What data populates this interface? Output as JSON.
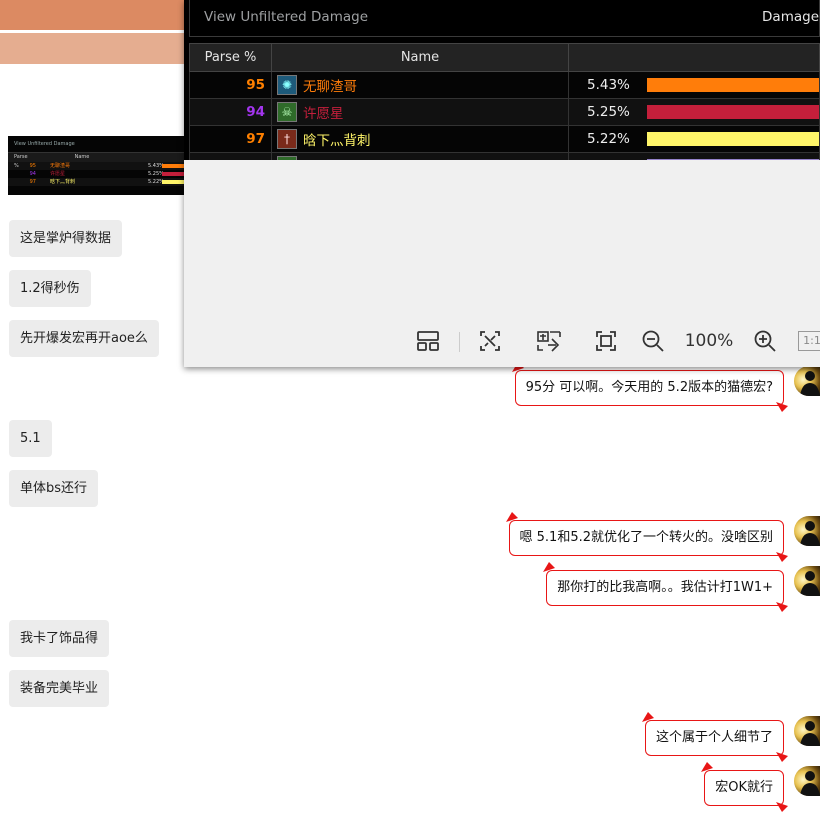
{
  "viewer": {
    "header_left": "View Unfiltered Damage",
    "header_right": "Damage",
    "columns": {
      "parse": "Parse %",
      "name": "Name"
    },
    "rows": [
      {
        "parse": "95",
        "parse_color": "#ff8000",
        "name": "无聊渣哥",
        "name_color": "#ff7d0a",
        "pct": "5.43%",
        "bar_color": "#ff7d0a",
        "icon": "fire-icon"
      },
      {
        "parse": "94",
        "parse_color": "#a335ee",
        "name": "许愿星",
        "name_color": "#c41f3b",
        "pct": "5.25%",
        "bar_color": "#c41f3b",
        "icon": "skull-icon"
      },
      {
        "parse": "97",
        "parse_color": "#ff8000",
        "name": "晗下灬背刺",
        "name_color": "#fff569",
        "pct": "5.22%",
        "bar_color": "#fff569",
        "icon": "dagger-icon"
      }
    ],
    "toolbar": {
      "zoom": "100%",
      "one_to_one": "1:1"
    }
  },
  "thumbnail": {
    "header": "View Unfiltered Damage",
    "col_parse": "Parse %",
    "col_name": "Name"
  },
  "chat": {
    "left": [
      {
        "text": "这是掌炉得数据"
      },
      {
        "text": "1.2得秒伤"
      },
      {
        "text": "先开爆发宏再开aoe么"
      },
      {
        "text": "5.1"
      },
      {
        "text": "单体bs还行"
      },
      {
        "text": "我卡了饰品得"
      },
      {
        "text": "装备完美毕业"
      }
    ],
    "right": [
      {
        "text": "95分 可以啊。今天用的 5.2版本的猫德宏?"
      },
      {
        "text": "嗯 5.1和5.2就优化了一个转火的。没啥区别"
      },
      {
        "text": "那你打的比我高啊。。我估计打1W1+"
      },
      {
        "text": "这个属于个人细节了"
      },
      {
        "text": "宏OK就行"
      }
    ]
  }
}
